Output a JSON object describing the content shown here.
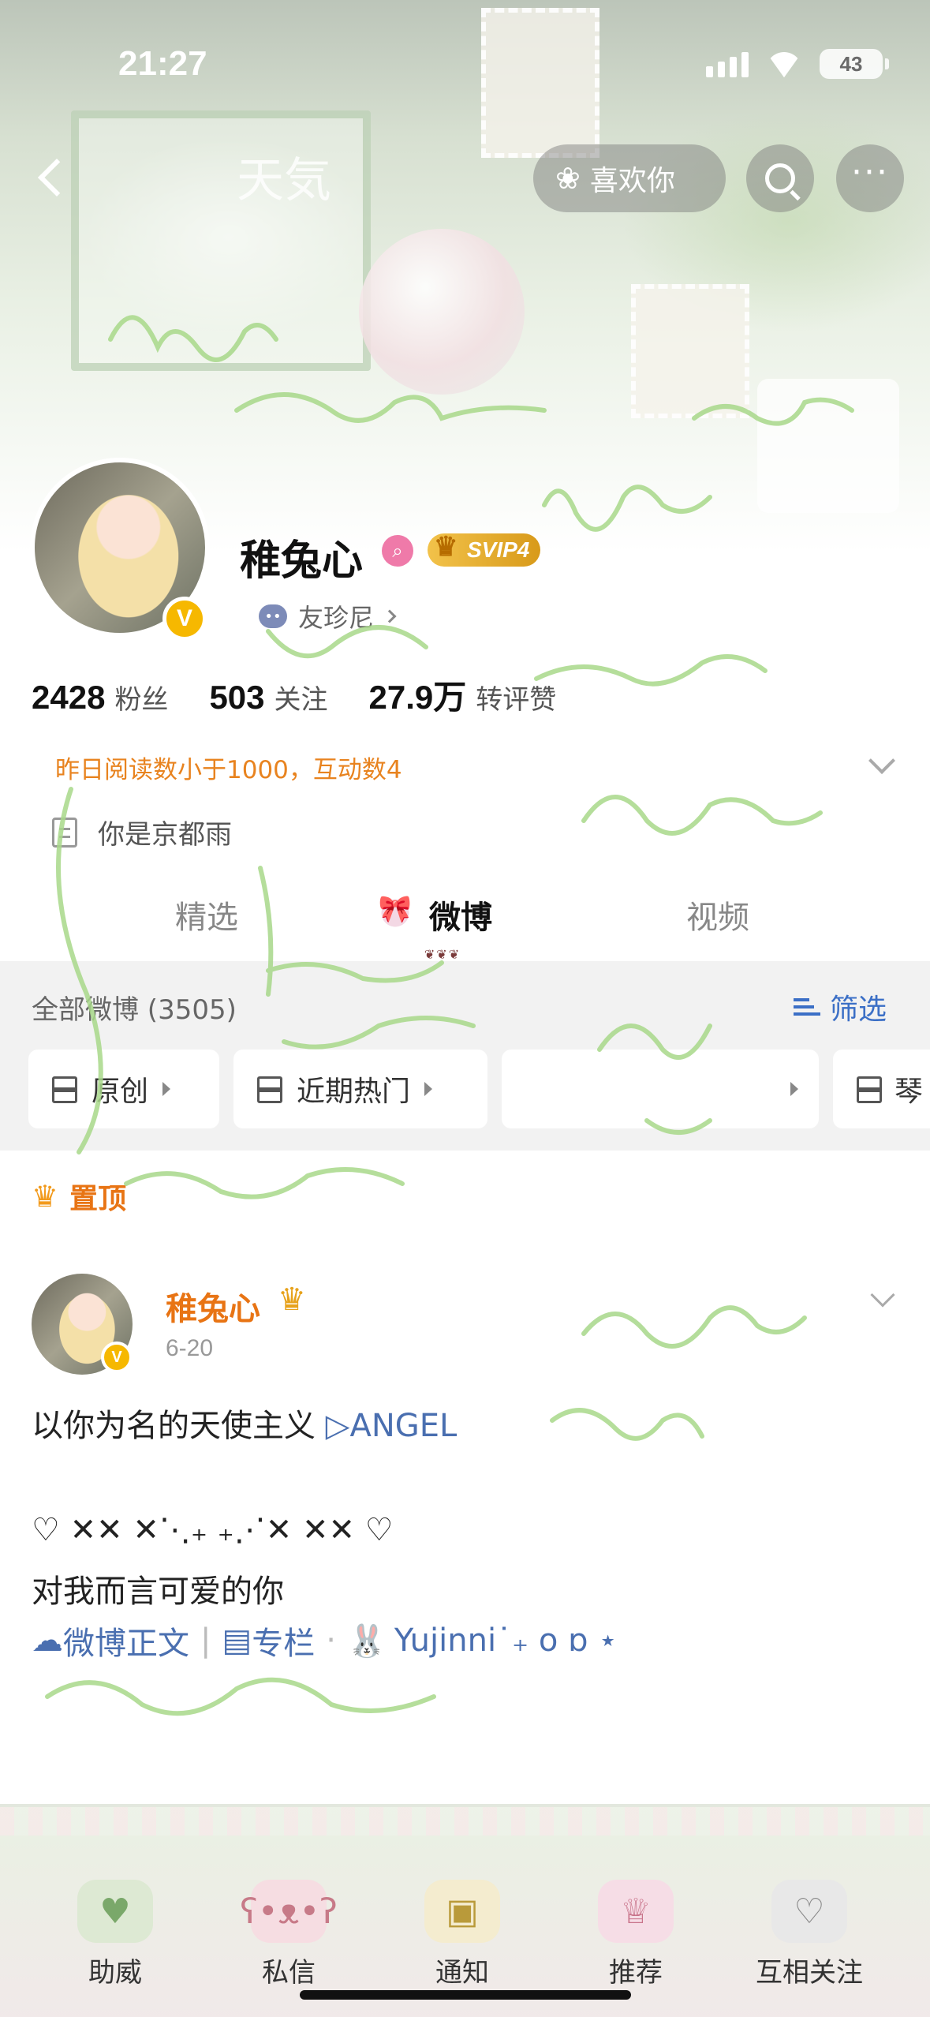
{
  "status_bar": {
    "time": "21:27",
    "battery": "43"
  },
  "nav": {
    "like_label": "喜欢你"
  },
  "banner": {
    "title_text": "天気"
  },
  "profile": {
    "name": "稚兔心",
    "vip_badge": "SVIP4",
    "friend_label": "友珍尼",
    "stats": [
      {
        "num": "2428",
        "label": "粉丝"
      },
      {
        "num": "503",
        "label": "关注"
      },
      {
        "num": "27.9万",
        "label": "转评赞"
      }
    ],
    "read_stat": "昨日阅读数小于1000，互动数4",
    "bio": "你是京都雨"
  },
  "tabs": [
    {
      "label": "精选",
      "active": false
    },
    {
      "label": "微博",
      "active": true
    },
    {
      "label": "视频",
      "active": false
    }
  ],
  "feed": {
    "all_count": "全部微博 (3505)",
    "filter_label": "筛选",
    "chips": [
      "原创",
      "近期热门",
      "",
      "琴"
    ]
  },
  "pinned_label": "置顶",
  "post": {
    "author": "稚兔心",
    "date": "6-20",
    "line1_text": "以你为名的天使主义",
    "line1_link": "▷ANGEL",
    "line2": "♡ ✕✕ ✕⋱₊ ₊⋰✕ ✕✕ ♡",
    "line3": "对我而言可爱的你",
    "link_weibo": "微博正文",
    "link_column": "专栏",
    "link_user": "Yujinni˙₊ o ɒ ⋆"
  },
  "bottom_bar": {
    "items": [
      {
        "label": "助威",
        "icon": "heart-icon"
      },
      {
        "label": "私信",
        "icon": "bear-icon"
      },
      {
        "label": "通知",
        "icon": "cube-icon"
      },
      {
        "label": "推荐",
        "icon": "cake-icon"
      },
      {
        "label": "互相关注",
        "icon": "glasses-heart-icon"
      }
    ]
  }
}
